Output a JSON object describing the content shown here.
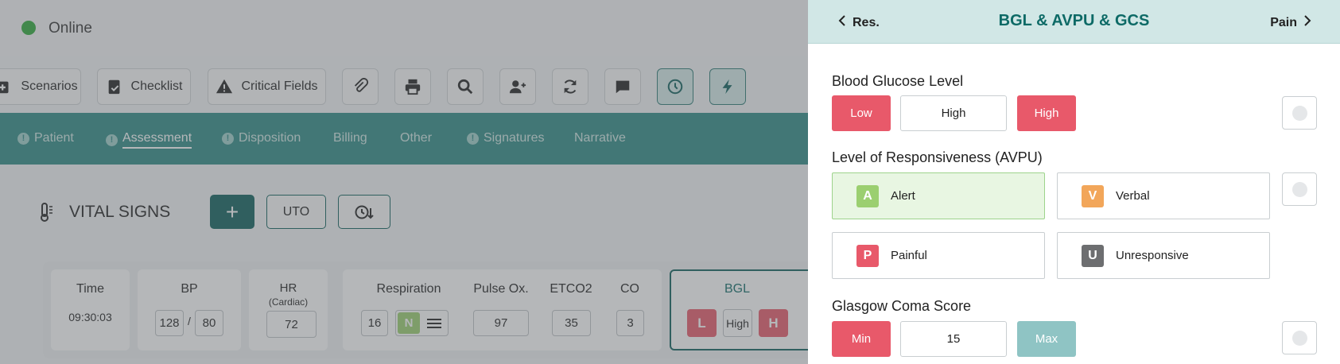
{
  "status": {
    "label": "Online",
    "color": "#2faa3a"
  },
  "toolbar": {
    "scenarios": "Scenarios",
    "checklist": "Checklist",
    "critical_fields": "Critical Fields"
  },
  "nav": {
    "tabs": [
      "Patient",
      "Assessment",
      "Disposition",
      "Billing",
      "Other",
      "Signatures",
      "Narrative"
    ],
    "active": "Assessment"
  },
  "vitals": {
    "title": "VITAL SIGNS",
    "uto": "UTO",
    "time": {
      "label": "Time",
      "value": "09:30:03"
    },
    "bp": {
      "label": "BP",
      "systolic": "128",
      "sep": "/",
      "diastolic": "80"
    },
    "hr": {
      "label": "HR",
      "sub": "(Cardiac)",
      "value": "72"
    },
    "resp": {
      "label": "Respiration",
      "value": "16",
      "badge": "N"
    },
    "pulseox": {
      "label": "Pulse Ox.",
      "value": "97"
    },
    "etco2": {
      "label": "ETCO2",
      "value": "35"
    },
    "co": {
      "label": "CO",
      "value": "3"
    },
    "bgl": {
      "label": "BGL",
      "low": "L",
      "mid": "High",
      "high": "H"
    }
  },
  "panel": {
    "prev": "Res.",
    "title": "BGL & AVPU & GCS",
    "next": "Pain",
    "bgl": {
      "title": "Blood Glucose Level",
      "low": "Low",
      "value": "High",
      "high": "High"
    },
    "avpu": {
      "title": "Level of Responsiveness (AVPU)",
      "alert": {
        "letter": "A",
        "label": "Alert"
      },
      "verbal": {
        "letter": "V",
        "label": "Verbal"
      },
      "painful": {
        "letter": "P",
        "label": "Painful"
      },
      "unresponsive": {
        "letter": "U",
        "label": "Unresponsive"
      }
    },
    "gcs": {
      "title": "Glasgow Coma Score",
      "min": "Min",
      "value": "15",
      "max": "Max"
    }
  },
  "colors": {
    "teal": "#2f8b86",
    "dark_teal": "#0d5f5b",
    "red": "#e8596a",
    "green": "#9bcf70",
    "orange": "#f2a65a",
    "gray": "#6d6e70"
  }
}
